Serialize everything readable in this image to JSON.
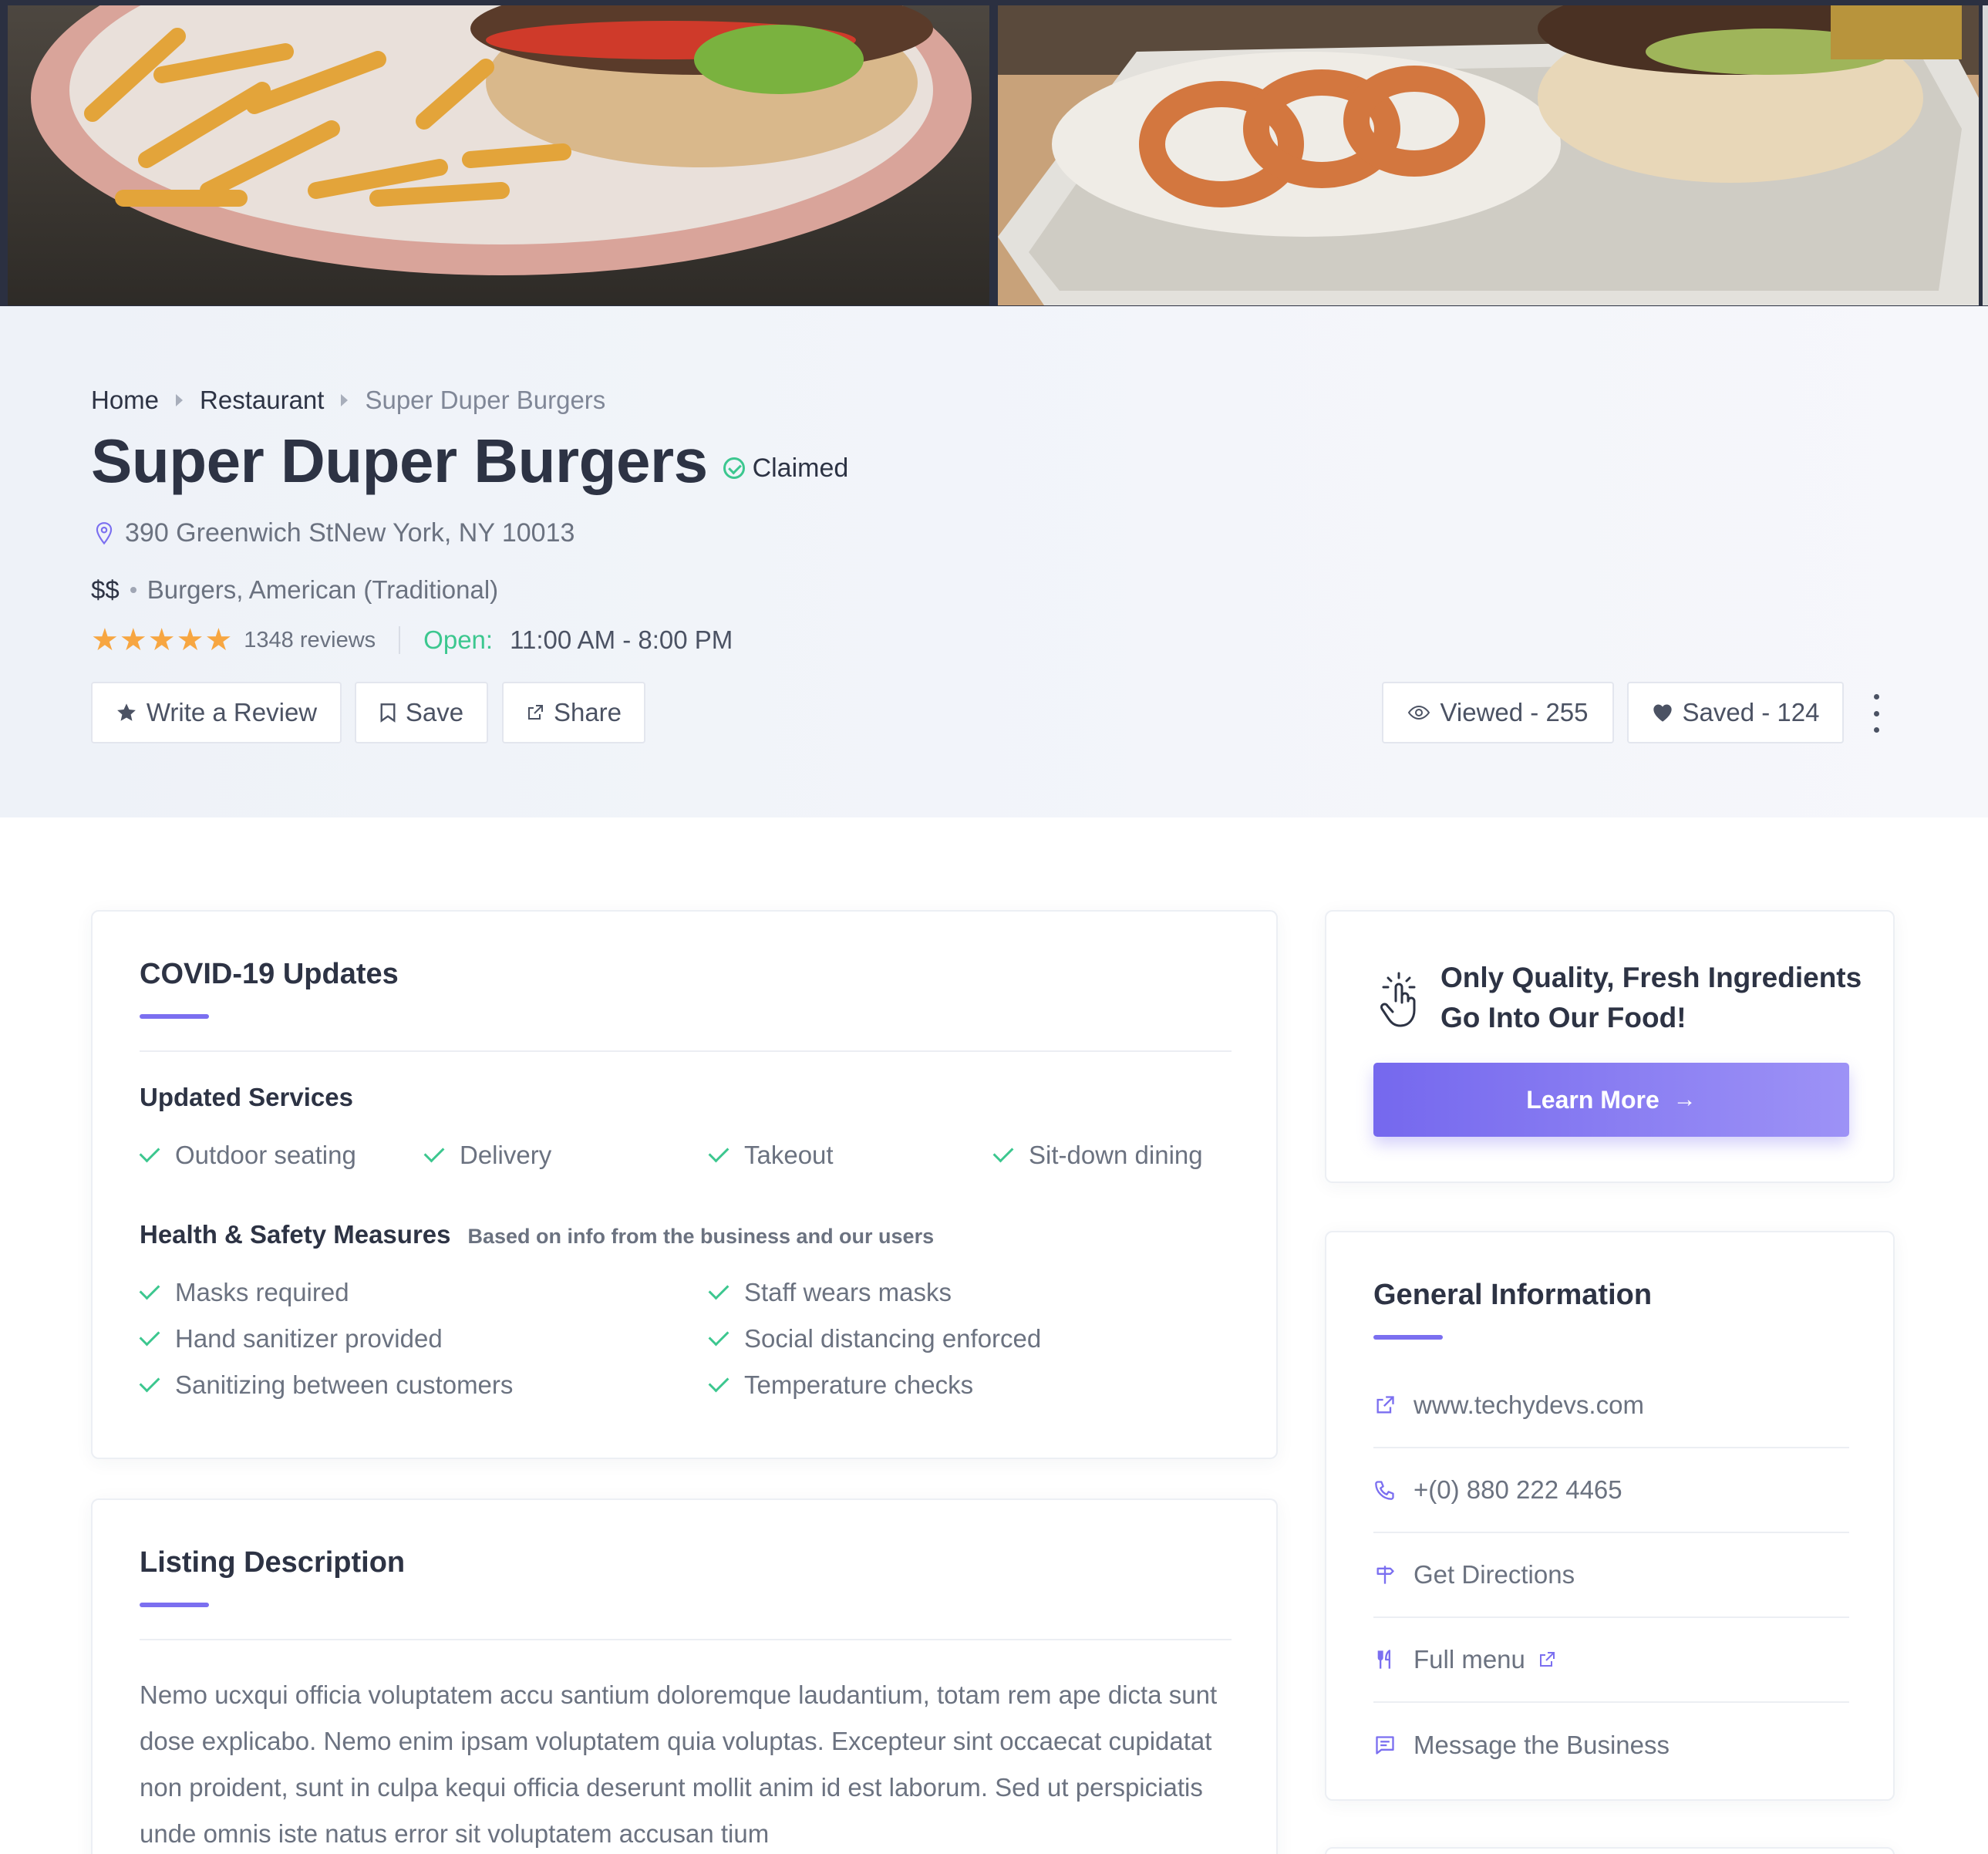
{
  "breadcrumb": {
    "home": "Home",
    "category": "Restaurant",
    "current": "Super Duper Burgers"
  },
  "listing": {
    "title": "Super Duper Burgers",
    "claimed": "Claimed",
    "address": "390 Greenwich StNew York, NY 10013",
    "price": "$$",
    "cuisine": "Burgers, American (Traditional)",
    "rating": 5,
    "reviews": "1348 reviews",
    "open_label": "Open:",
    "hours": "11:00 AM - 8:00 PM"
  },
  "actions": {
    "write_review": "Write a Review",
    "save": "Save",
    "share": "Share",
    "viewed": "Viewed - 255",
    "saved": "Saved - 124"
  },
  "covid": {
    "title": "COVID-19 Updates",
    "services_title": "Updated Services",
    "services": [
      "Outdoor seating",
      "Delivery",
      "Takeout",
      "Sit-down dining"
    ],
    "measures_title": "Health & Safety Measures",
    "measures_note": "Based on info from the business and our users",
    "measures": [
      "Masks required",
      "Staff wears masks",
      "Hand sanitizer provided",
      "Social distancing enforced",
      "Sanitizing between customers",
      "Temperature checks"
    ]
  },
  "description": {
    "title": "Listing Description",
    "text": "Nemo ucxqui officia voluptatem accu santium doloremque laudantium, totam rem ape dicta sunt dose explicabo. Nemo enim ipsam voluptatem quia voluptas. Excepteur sint occaecat cupidatat non proident, sunt in culpa kequi officia deserunt mollit anim id est laborum. Sed ut perspiciatis unde omnis iste natus error sit voluptatem accusan tium"
  },
  "promo": {
    "text": "Only Quality, Fresh Ingredients Go Into Our Food!",
    "button": "Learn More"
  },
  "general_info": {
    "title": "General Information",
    "website": "www.techydevs.com",
    "phone": "+(0) 880 222 4465",
    "directions": "Get Directions",
    "menu": "Full menu",
    "message": "Message the Business"
  },
  "colors": {
    "accent": "#7b6ff0",
    "green": "#3cc78f",
    "star": "#f7a641",
    "heading": "#2d3344",
    "text": "#6b7280"
  },
  "icons": {
    "location": "map-pin-icon",
    "review": "star-icon",
    "save": "bookmark-icon",
    "share": "external-link-icon",
    "viewed": "eye-icon",
    "saved": "heart-icon",
    "more": "kebab-menu-icon",
    "promo": "hand-pointer-icon",
    "website": "external-link-icon",
    "phone": "phone-icon",
    "directions": "signpost-icon",
    "menu": "utensils-icon",
    "message": "message-icon"
  }
}
